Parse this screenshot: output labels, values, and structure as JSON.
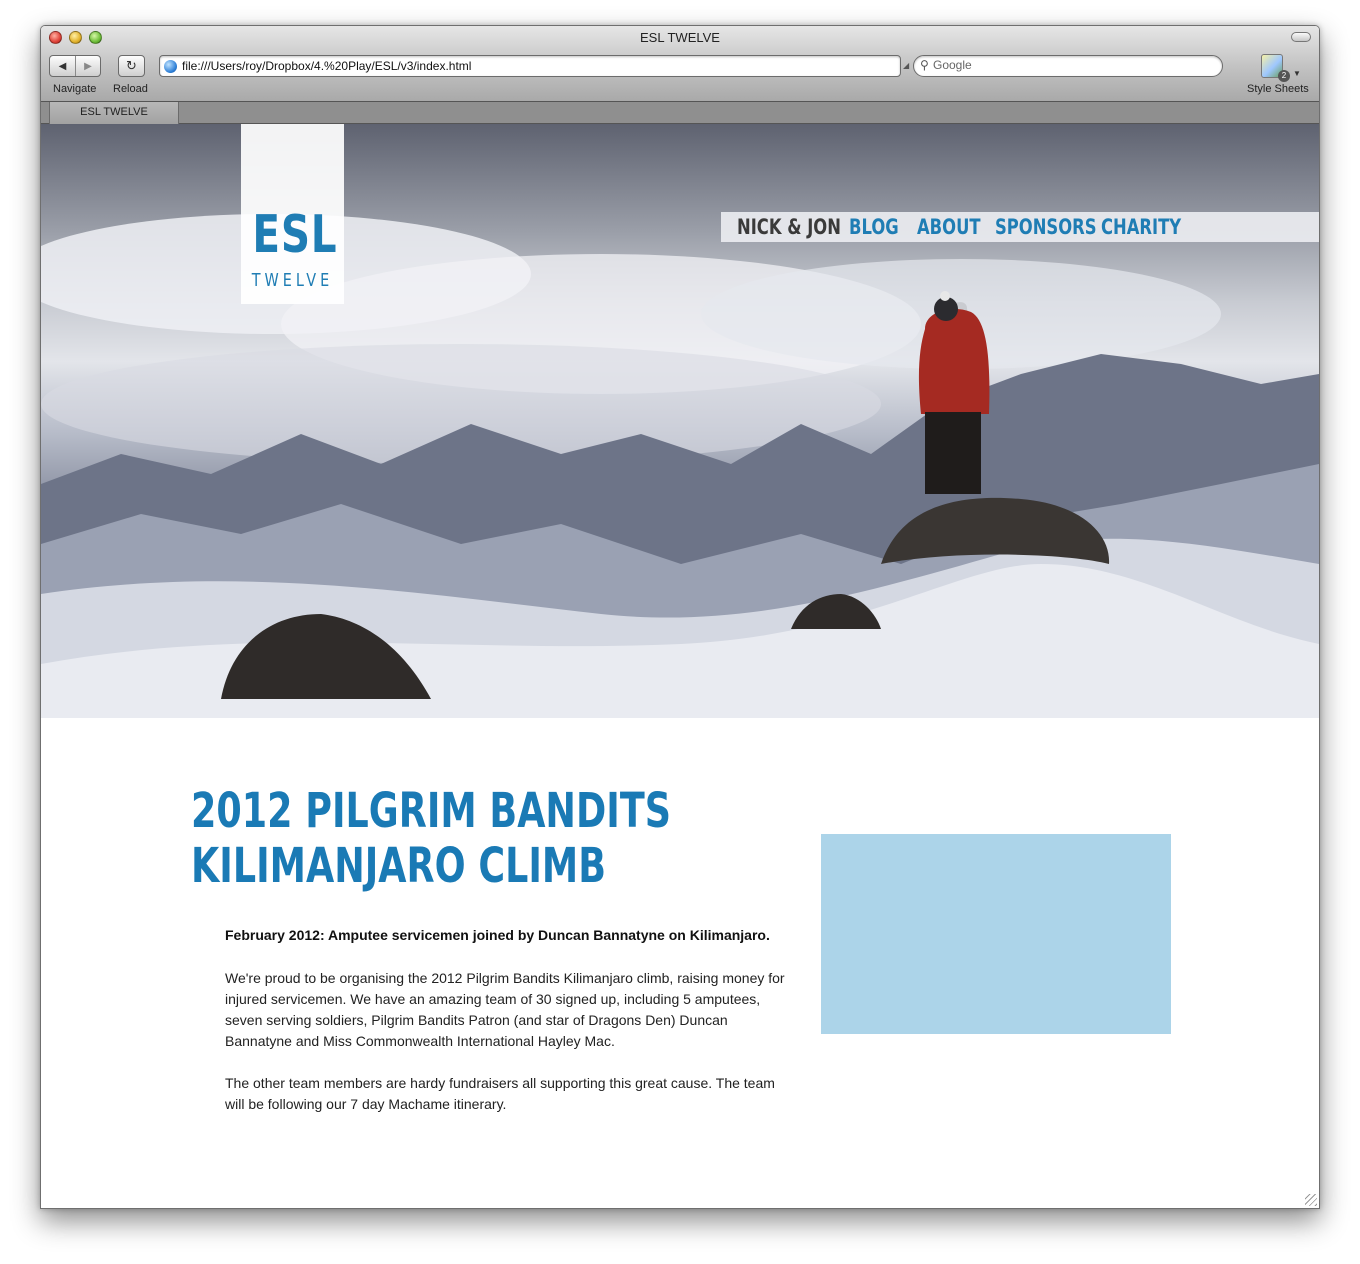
{
  "browser": {
    "window_title": "ESL TWELVE",
    "nav_label": "Navigate",
    "reload_label": "Reload",
    "back_glyph": "◀",
    "forward_glyph": "▶",
    "reload_glyph": "↻",
    "address": "file:///Users/roy/Dropbox/4.%20Play/ESL/v3/index.html",
    "search_placeholder": "Google",
    "style_sheets_label": "Style Sheets",
    "style_sheets_count": "2",
    "tab_label": "ESL TWELVE"
  },
  "site": {
    "logo": {
      "line1": "ESL",
      "line2": "TWELVE"
    },
    "nav": [
      {
        "label": "NICK & JON",
        "active": true
      },
      {
        "label": "BLOG"
      },
      {
        "label": "ABOUT"
      },
      {
        "label": "SPONSORS"
      },
      {
        "label": "CHARITY"
      }
    ],
    "headline": {
      "line1": "2012 PILGRIM BANDITS",
      "line2": "KILIMANJARO CLIMB"
    },
    "lead": "February 2012: Amputee servicemen joined by Duncan Bannatyne on Kilimanjaro.",
    "paragraphs": [
      "We're proud to be organising the 2012 Pilgrim Bandits Kilimanjaro climb, raising money for injured servicemen. We have an amazing team of 30 signed up, including 5 amputees, seven serving soldiers, Pilgrim Bandits Patron (and star of Dragons Den) Duncan Bannatyne and Miss Commonwealth International Hayley Mac.",
      "The other team members are hardy fundraisers all supporting this great cause. The team will be following our 7 day Machame itinerary."
    ]
  },
  "colors": {
    "brand_blue": "#1f7db4",
    "nav_active": "#3a3a3a",
    "media_placeholder": "#acd4e9"
  }
}
